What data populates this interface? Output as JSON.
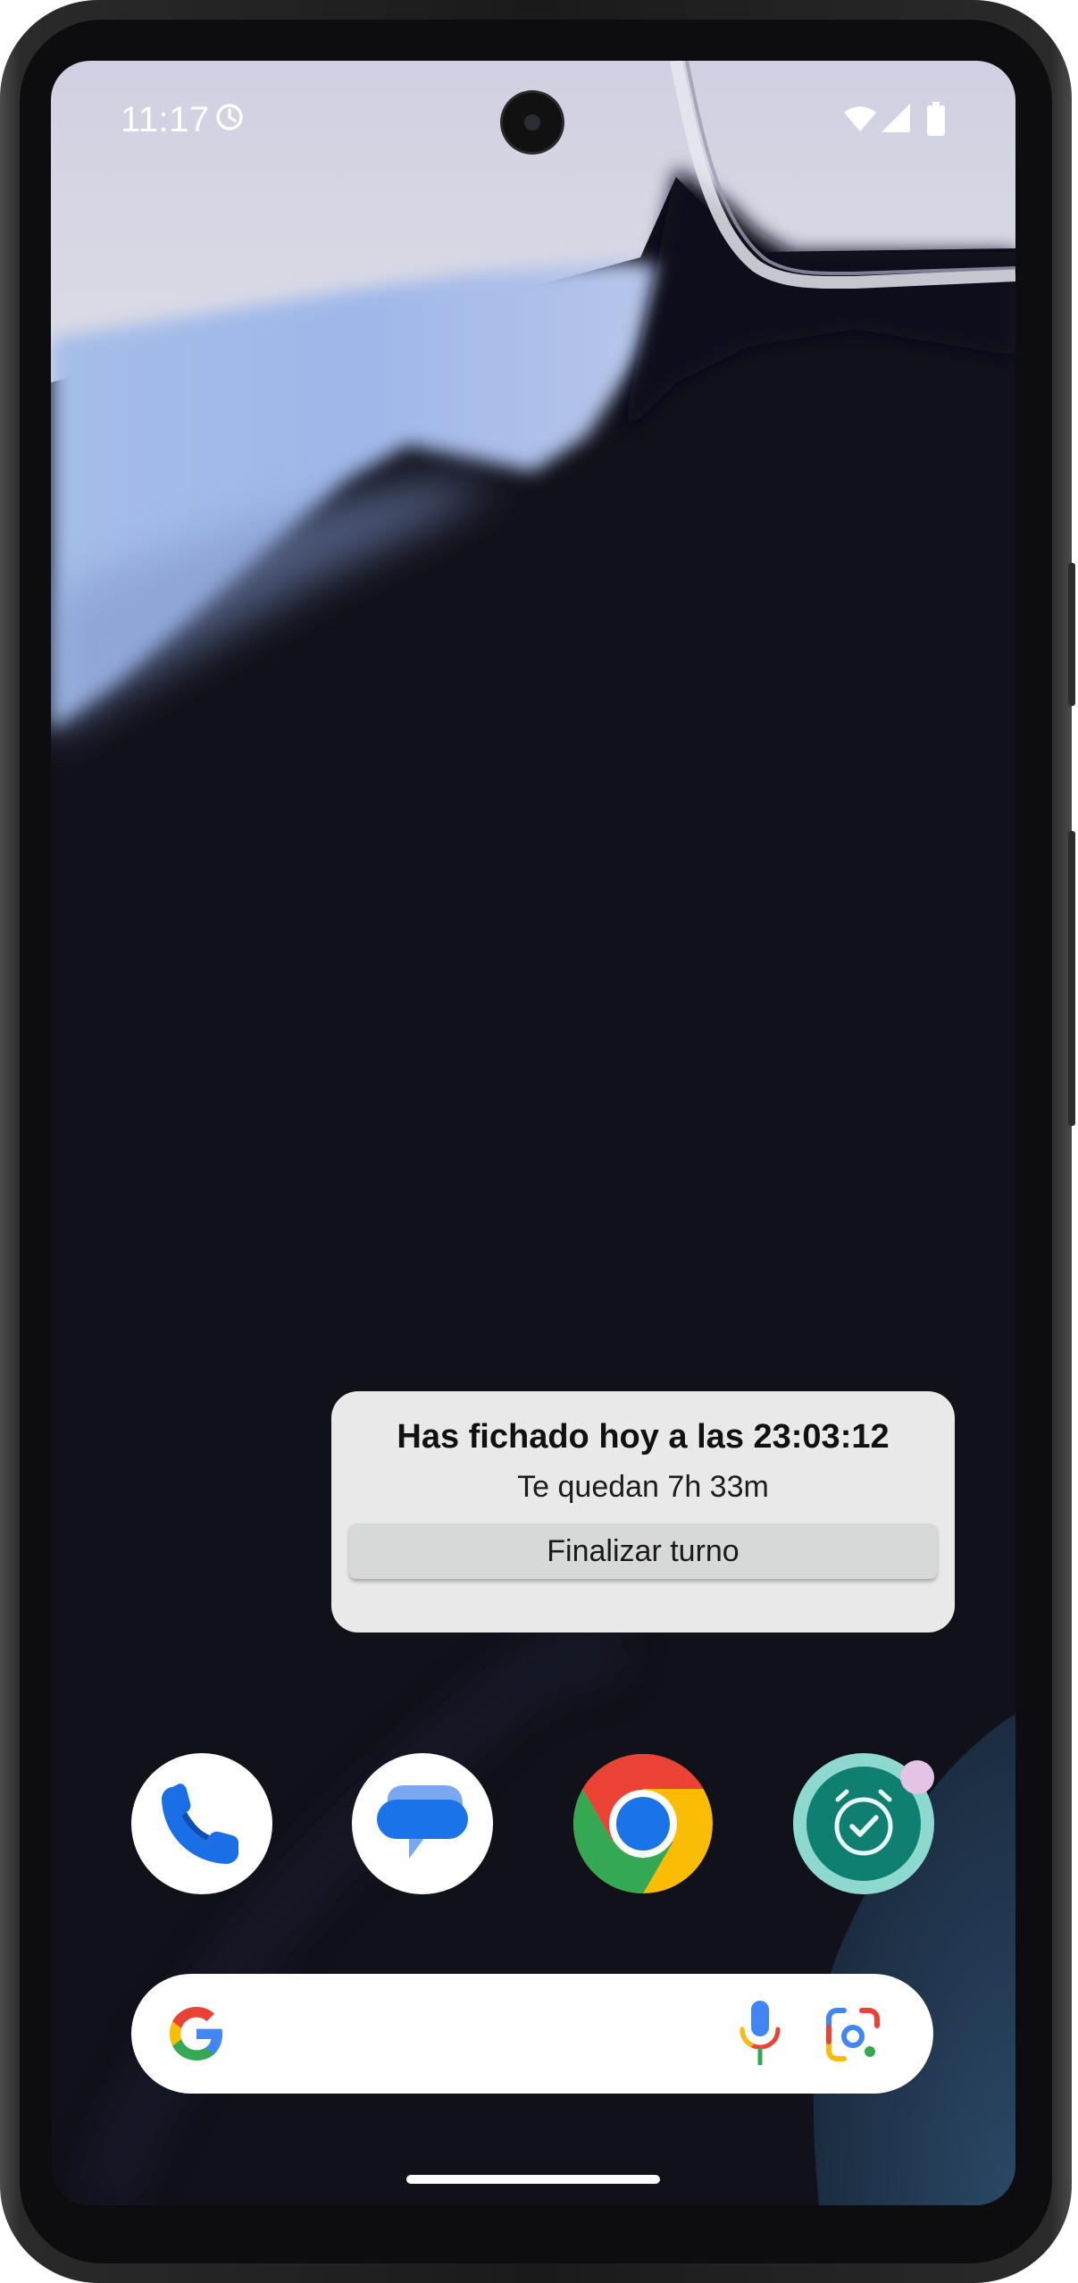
{
  "status_bar": {
    "time": "11:17",
    "icons": [
      "alarm-icon",
      "wifi-icon",
      "cell-signal-icon",
      "battery-icon"
    ]
  },
  "widget": {
    "title": "Has fichado hoy a las 23:03:12",
    "subtitle": "Te quedan 7h 33m",
    "button_label": "Finalizar turno"
  },
  "dock": {
    "apps": [
      "phone-app-icon",
      "messages-app-icon",
      "chrome-app-icon",
      "clock-app-icon"
    ]
  },
  "search_bar": {
    "icons": [
      "google-g-icon",
      "microphone-icon",
      "google-lens-icon"
    ]
  },
  "colors": {
    "wallpaper_dark": "#11111a",
    "widget_bg": "#e9e9e9",
    "widget_button_bg": "#d7d8d8",
    "clock_icon_teal": "#0e7f71",
    "clock_icon_ring": "#8ed9cf",
    "notification_dot": "#e4c4e6"
  }
}
